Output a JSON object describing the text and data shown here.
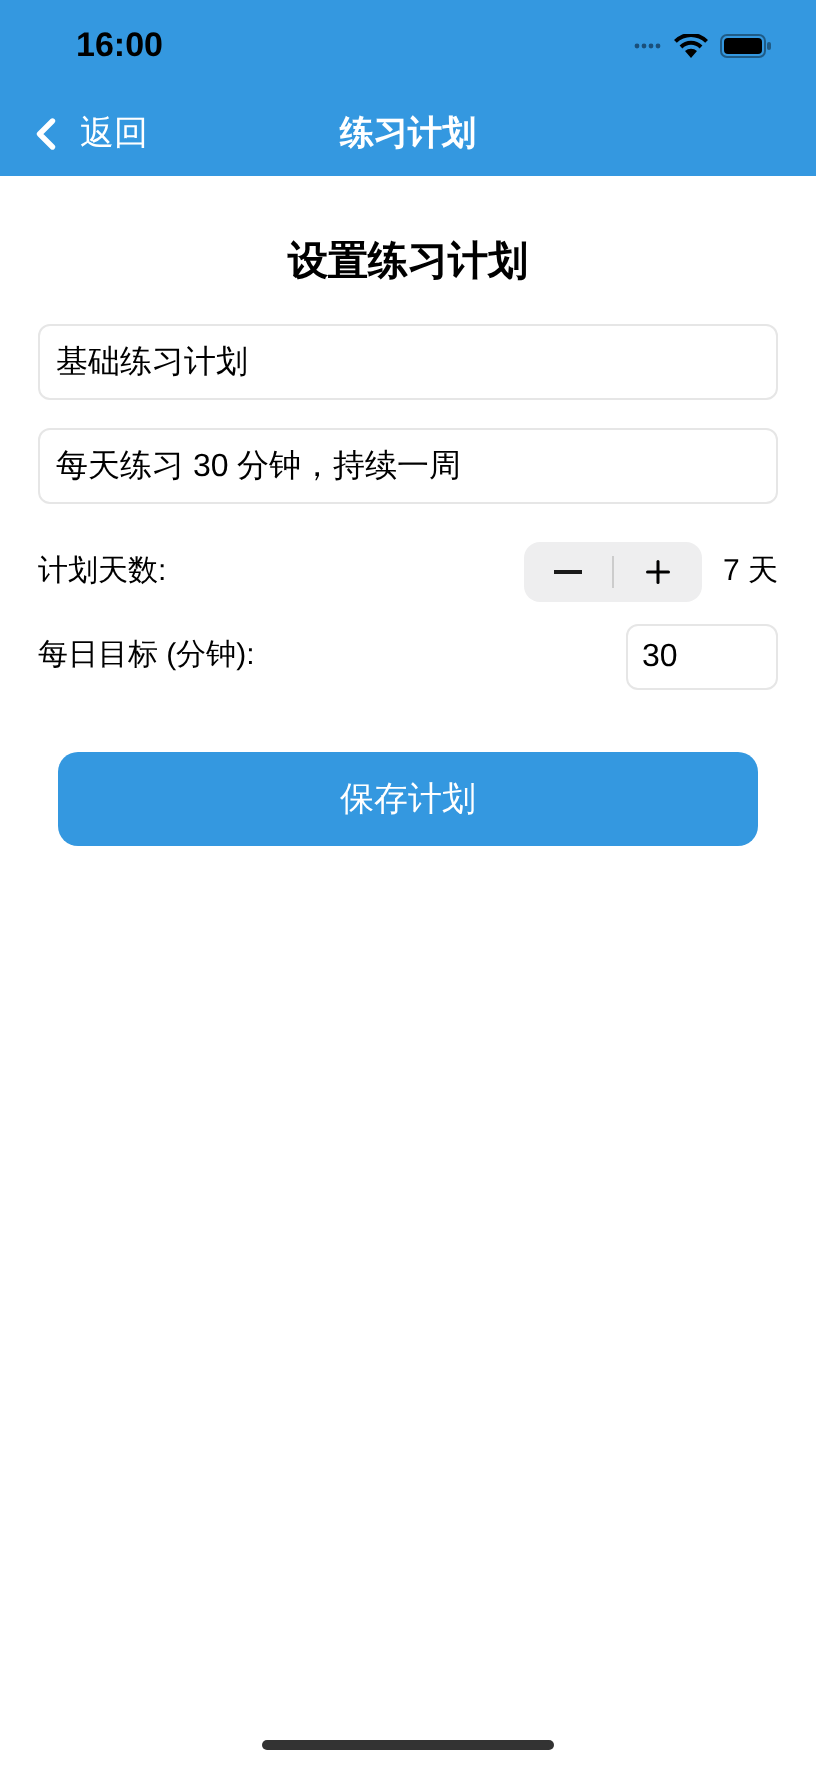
{
  "status_bar": {
    "time": "16:00"
  },
  "nav": {
    "back": "返回",
    "title": "练习计划"
  },
  "heading": "设置练习计划",
  "fields": [
    {
      "value": "基础练习计划"
    },
    {
      "value": "每天练习 30 分钟，持续一周"
    }
  ],
  "days": {
    "label": "计划天数:",
    "value": "7 天"
  },
  "daily": {
    "label": "每日目标 (分钟):",
    "value": "30"
  },
  "save_button": "保存计划"
}
